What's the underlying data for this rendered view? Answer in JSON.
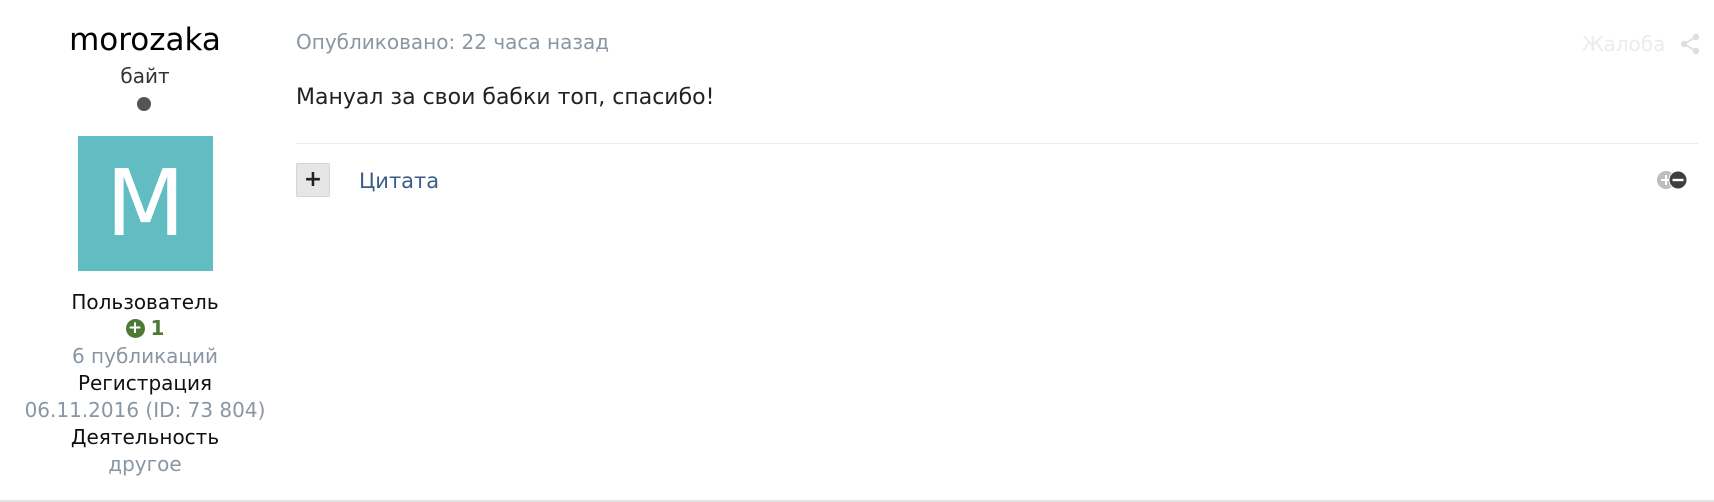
{
  "author": {
    "username": "morozaka",
    "rank": "байт",
    "avatar_letter": "M",
    "avatar_color": "#62bdc3",
    "group": "Пользователь",
    "reputation": "1",
    "posts_count": "6 публикаций",
    "registration_label": "Регистрация",
    "registration_value": "06.11.2016 (ID: 73 804)",
    "activity_label": "Деятельность",
    "activity_value": "другое"
  },
  "post": {
    "posted": "Опубликовано: 22 часа назад",
    "report_label": "Жалоба",
    "body": "Мануал за свои бабки топ, спасибо!",
    "multiquote_label": "+",
    "quote_label": "Цитата"
  },
  "icons": {
    "status": "offline-dot-icon",
    "reputation": "plus-circle-icon",
    "share": "share-icon",
    "reaction": "reaction-icon"
  },
  "colors": {
    "accent_link": "#3a5f86",
    "muted_text": "#8a96a3",
    "reputation_green": "#4f7a35"
  }
}
